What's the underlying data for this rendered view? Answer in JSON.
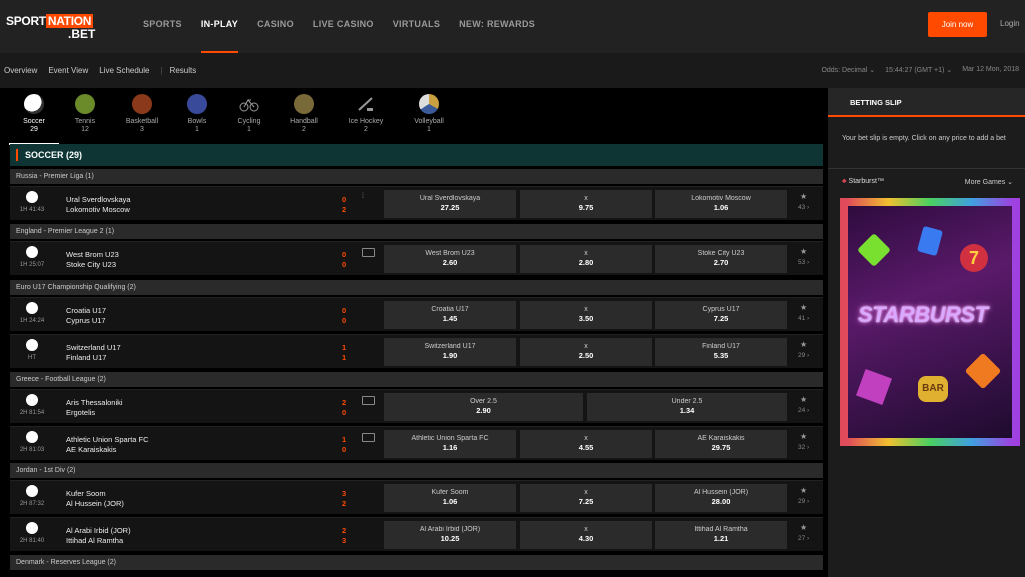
{
  "header": {
    "logo_part1": "SPORT",
    "logo_part2": "NATION",
    "logo_part3": ".BET",
    "nav": [
      "SPORTS",
      "IN-PLAY",
      "CASINO",
      "LIVE CASINO",
      "VIRTUALS",
      "NEW: REWARDS"
    ],
    "join_label": "Join now",
    "login_label": "Login"
  },
  "subnav": {
    "items": [
      "Overview",
      "Event View",
      "Live Schedule",
      "Results"
    ],
    "odds": "Odds: Decimal ⌄",
    "time": "15:44:27 (GMT +1) ⌄",
    "date": "Mar 12 Mon, 2018"
  },
  "sports": [
    {
      "name": "Soccer",
      "count": "29",
      "icon": "soccer-ball-icon",
      "color": "#ffffff"
    },
    {
      "name": "Tennis",
      "count": "12",
      "icon": "tennis-ball-icon",
      "color": "#6b8a2a"
    },
    {
      "name": "Basketball",
      "count": "3",
      "icon": "basketball-icon",
      "color": "#8a3a1a"
    },
    {
      "name": "Bowls",
      "count": "1",
      "icon": "bowls-icon",
      "color": "#3a4a9a"
    },
    {
      "name": "Cycling",
      "count": "1",
      "icon": "bicycle-icon",
      "color": "#888888"
    },
    {
      "name": "Handball",
      "count": "2",
      "icon": "handball-icon",
      "color": "#7a6a3a"
    },
    {
      "name": "Ice Hockey",
      "count": "2",
      "icon": "ice-hockey-icon",
      "color": "#888888"
    },
    {
      "name": "Volleyball",
      "count": "1",
      "icon": "volleyball-icon",
      "color": "#c8a040"
    }
  ],
  "section_title": "SOCCER (29)",
  "leagues": [
    "Russia - Premier Liga (1)",
    "England - Premier League 2 (1)",
    "Euro U17 Championship Qualifying (2)",
    "Greece - Football League (2)",
    "Jordan - 1st Div (2)",
    "Denmark - Reserves League (2)"
  ],
  "matches": [
    {
      "time": "1H 41:43",
      "team1": "Ural Sverdlovskaya",
      "team2": "Lokomotiv Moscow",
      "score1": "0",
      "score2": "2",
      "o1_name": "Ural Sverdlovskaya",
      "o1_price": "27.25",
      "ox_name": "x",
      "ox_price": "9.75",
      "o2_name": "Lokomotiv Moscow",
      "o2_price": "1.06",
      "more": "43 ›"
    },
    {
      "time": "1H 25:07",
      "team1": "West Brom U23",
      "team2": "Stoke City U23",
      "score1": "0",
      "score2": "0",
      "o1_name": "West Brom U23",
      "o1_price": "2.60",
      "ox_name": "x",
      "ox_price": "2.80",
      "o2_name": "Stoke City U23",
      "o2_price": "2.70",
      "more": "53 ›"
    },
    {
      "time": "1H 24:24",
      "team1": "Croatia U17",
      "team2": "Cyprus U17",
      "score1": "0",
      "score2": "0",
      "o1_name": "Croatia U17",
      "o1_price": "1.45",
      "ox_name": "x",
      "ox_price": "3.50",
      "o2_name": "Cyprus U17",
      "o2_price": "7.25",
      "more": "41 ›"
    },
    {
      "time": "HT",
      "team1": "Switzerland U17",
      "team2": "Finland U17",
      "score1": "1",
      "score2": "1",
      "o1_name": "Switzerland U17",
      "o1_price": "1.90",
      "ox_name": "x",
      "ox_price": "2.50",
      "o2_name": "Finland U17",
      "o2_price": "5.35",
      "more": "29 ›"
    },
    {
      "time": "2H 81:54",
      "team1": "Aris Thessaloniki",
      "team2": "Ergotelis",
      "score1": "2",
      "score2": "0",
      "ou1_name": "Over 2.5",
      "ou1_price": "2.90",
      "ou2_name": "Under 2.5",
      "ou2_price": "1.34",
      "more": "24 ›"
    },
    {
      "time": "2H 81:03",
      "team1": "Athletic Union Sparta FC",
      "team2": "AE Karaiskakis",
      "score1": "1",
      "score2": "0",
      "o1_name": "Athletic Union Sparta FC",
      "o1_price": "1.16",
      "ox_name": "x",
      "ox_price": "4.55",
      "o2_name": "AE Karaiskakis",
      "o2_price": "29.75",
      "more": "32 ›"
    },
    {
      "time": "2H 87:32",
      "team1": "Kufer Soom",
      "team2": "Al Hussein (JOR)",
      "score1": "3",
      "score2": "2",
      "o1_name": "Kufer Soom",
      "o1_price": "1.06",
      "ox_name": "x",
      "ox_price": "7.25",
      "o2_name": "Al Hussein (JOR)",
      "o2_price": "28.00",
      "more": "29 ›"
    },
    {
      "time": "2H 81:40",
      "team1": "Al Arabi Irbid (JOR)",
      "team2": "Ittihad Al Ramtha",
      "score1": "2",
      "score2": "3",
      "o1_name": "Al Arabi Irbid (JOR)",
      "o1_price": "10.25",
      "ox_name": "x",
      "ox_price": "4.30",
      "o2_name": "Ittihad Al Ramtha",
      "o2_price": "1.21",
      "more": "27 ›"
    }
  ],
  "slip": {
    "title": "BETTING SLIP",
    "empty_text": "Your bet slip is empty. Click on any price to add a bet",
    "game_name": "Starburst™",
    "more_games": "More Games ⌄",
    "promo_title": "STARBURST"
  }
}
